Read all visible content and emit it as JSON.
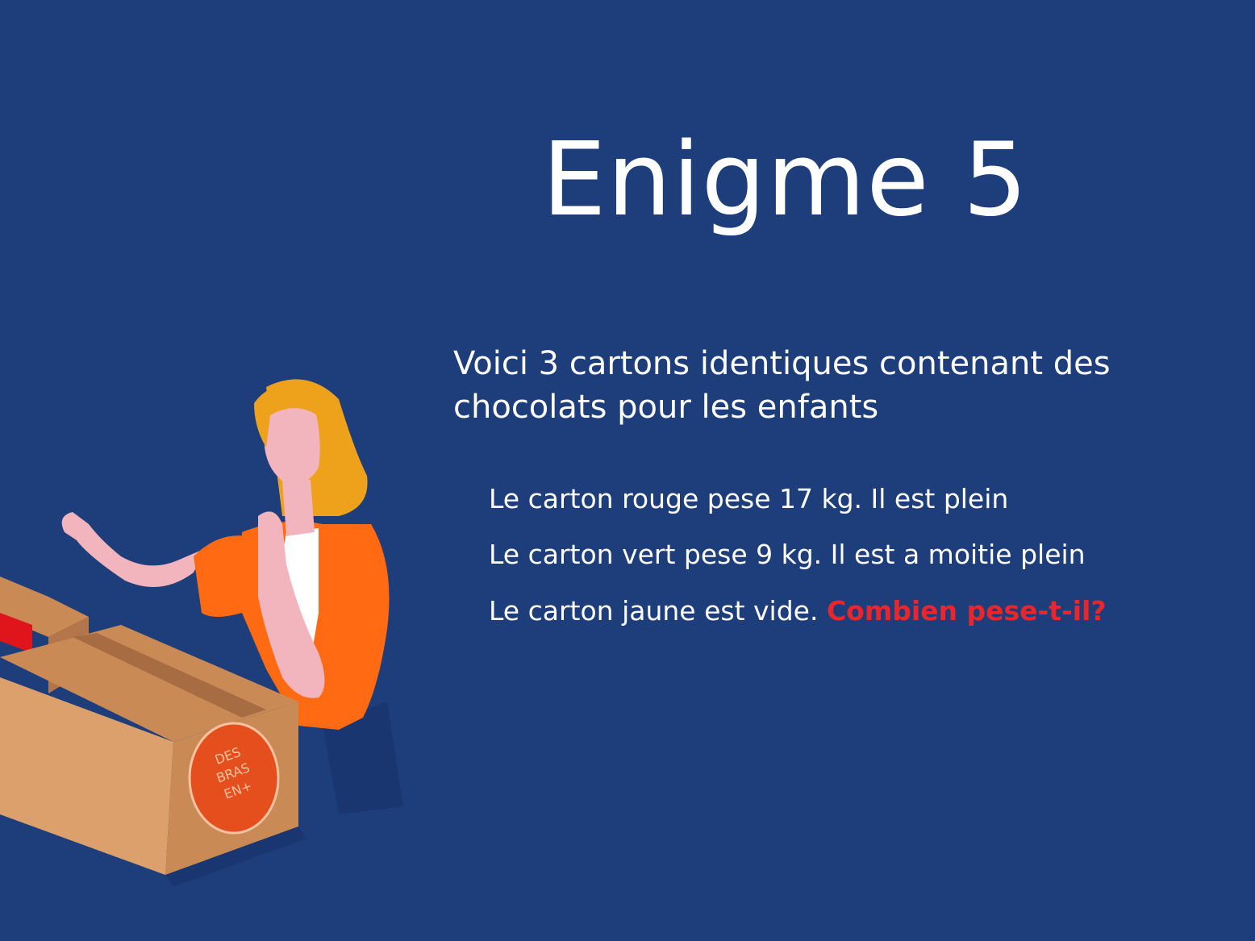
{
  "slide": {
    "title": "Enigme 5",
    "intro": "Voici 3 cartons identiques contenant des chocolats pour les enfants",
    "clues": [
      "Le carton rouge pese 17 kg. Il est plein",
      "Le carton vert pese 9 kg. Il est a moitie plein",
      "Le carton jaune est vide."
    ],
    "question": "Combien pese-t-il?"
  },
  "illustration": {
    "box_seal_text": [
      "DES",
      "BRAS",
      "EN+"
    ]
  },
  "colors": {
    "background": "#1e3e7b",
    "text": "#ffffff",
    "question": "#e8262b",
    "box": "#dba06c",
    "shirt": "#ff6a13",
    "hair": "#eea11b",
    "skin": "#f2b5bd"
  }
}
